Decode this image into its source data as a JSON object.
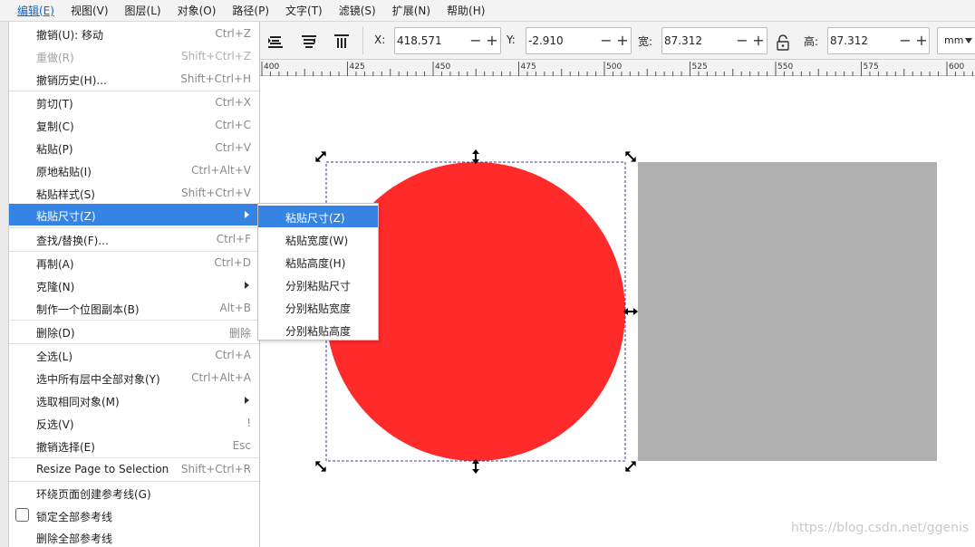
{
  "menubar": {
    "items": [
      "编辑(E)",
      "视图(V)",
      "图层(L)",
      "对象(O)",
      "路径(P)",
      "文字(T)",
      "滤镜(S)",
      "扩展(N)",
      "帮助(H)"
    ]
  },
  "toolbar": {
    "x_label": "X:",
    "x_value": "418.571",
    "y_label": "Y:",
    "y_value": "-2.910",
    "w_label": "宽:",
    "w_value": "87.312",
    "h_label": "高:",
    "h_value": "87.312",
    "minus": "−",
    "plus": "+",
    "unit": "mm",
    "icons": [
      "align-bottom-icon",
      "align-middle-icon",
      "align-top-icon",
      "lock-icon",
      "chevron-down-icon"
    ]
  },
  "ruler": {
    "labels": [
      "400",
      "425",
      "450",
      "475",
      "500",
      "525",
      "550",
      "575",
      "600"
    ]
  },
  "edit_menu": {
    "items": [
      {
        "label": "撤销(U): 移动",
        "shortcut": "Ctrl+Z"
      },
      {
        "label": "重做(R)",
        "shortcut": "Shift+Ctrl+Z",
        "disabled": true
      },
      {
        "label": "撤销历史(H)...",
        "shortcut": "Shift+Ctrl+H"
      },
      {
        "label": "剪切(T)",
        "shortcut": "Ctrl+X"
      },
      {
        "label": "复制(C)",
        "shortcut": "Ctrl+C"
      },
      {
        "label": "粘贴(P)",
        "shortcut": "Ctrl+V"
      },
      {
        "label": "原地粘贴(I)",
        "shortcut": "Ctrl+Alt+V"
      },
      {
        "label": "粘贴样式(S)",
        "shortcut": "Shift+Ctrl+V"
      },
      {
        "label": "粘贴尺寸(Z)",
        "shortcut": "",
        "submenu": true,
        "highlighted": true
      },
      {
        "label": "查找/替换(F)...",
        "shortcut": "Ctrl+F"
      },
      {
        "label": "再制(A)",
        "shortcut": "Ctrl+D"
      },
      {
        "label": "克隆(N)",
        "shortcut": "",
        "submenu": true
      },
      {
        "label": "制作一个位图副本(B)",
        "shortcut": "Alt+B"
      },
      {
        "label": "删除(D)",
        "shortcut": "删除"
      },
      {
        "label": "全选(L)",
        "shortcut": "Ctrl+A"
      },
      {
        "label": "选中所有层中全部对象(Y)",
        "shortcut": "Ctrl+Alt+A"
      },
      {
        "label": "选取相同对象(M)",
        "shortcut": "",
        "submenu": true
      },
      {
        "label": "反选(V)",
        "shortcut": "!"
      },
      {
        "label": "撤销选择(E)",
        "shortcut": "Esc"
      },
      {
        "label": "Resize Page to Selection",
        "shortcut": "Shift+Ctrl+R"
      },
      {
        "label": "环绕页面创建参考线(G)",
        "shortcut": ""
      },
      {
        "label": "锁定全部参考线",
        "shortcut": "",
        "checkbox": true
      },
      {
        "label": "删除全部参考线",
        "shortcut": ""
      }
    ]
  },
  "submenu": {
    "items": [
      "粘贴尺寸(Z)",
      "粘贴宽度(W)",
      "粘贴高度(H)",
      "分别粘贴尺寸",
      "分别粘贴宽度",
      "分别粘贴高度"
    ]
  },
  "canvas": {
    "circle_color": "#ff2a2a",
    "rect_color": "#b0b0b0",
    "selection_color": "#3b3b9b"
  },
  "watermark": "https://blog.csdn.net/ggenis"
}
